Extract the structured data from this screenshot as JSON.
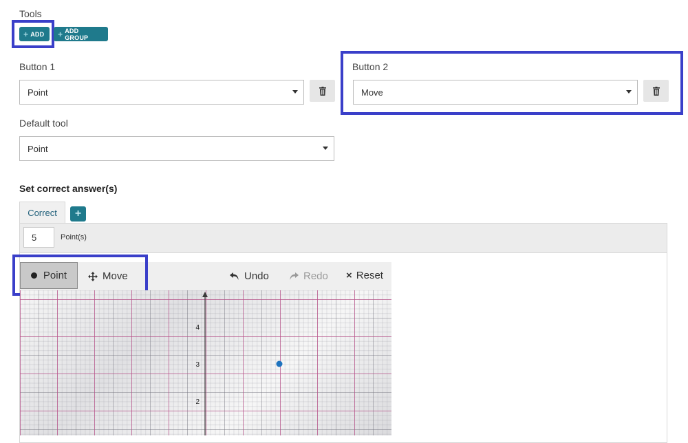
{
  "tools": {
    "heading": "Tools",
    "add_label": "ADD",
    "add_group_label": "ADD GROUP"
  },
  "buttons": [
    {
      "heading": "Button 1",
      "value": "Point"
    },
    {
      "heading": "Button 2",
      "value": "Move"
    }
  ],
  "default_tool": {
    "heading": "Default tool",
    "value": "Point"
  },
  "correct_answer": {
    "heading": "Set correct answer(s)",
    "tab_label": "Correct",
    "points_value": "5",
    "points_label": "Point(s)"
  },
  "graph_toolbar": {
    "point_label": "Point",
    "move_label": "Move",
    "undo_label": "Undo",
    "redo_label": "Redo",
    "reset_label": "Reset"
  },
  "graph": {
    "y_tick_labels": [
      "4",
      "3",
      "2"
    ],
    "point": {
      "x": 2,
      "y": 3
    }
  },
  "colors": {
    "accent": "#1f7a8c",
    "highlight": "#3a3fc9",
    "point": "#1e73be"
  }
}
